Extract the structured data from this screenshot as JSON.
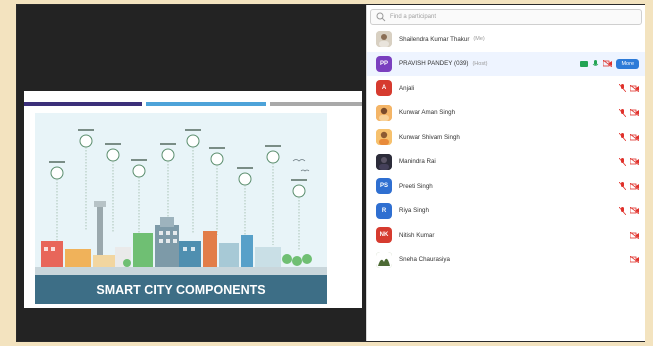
{
  "search": {
    "placeholder": "Find a participant"
  },
  "slide": {
    "caption": "SMART CITY COMPONENTS"
  },
  "participants": [
    {
      "name": "Shailendra Kumar Thakur",
      "tag": "(Me)",
      "initials": "",
      "avatar_color": "#cfc7b8",
      "avatar_type": "photo"
    },
    {
      "name": "PRAVISH PANDEY (039)",
      "tag": "(Host)",
      "initials": "PP",
      "avatar_color": "#7a3fbf",
      "avatar_type": "initials",
      "more_label": "More"
    },
    {
      "name": "Anjali",
      "tag": "",
      "initials": "A",
      "avatar_color": "#d63b2f",
      "avatar_type": "initials"
    },
    {
      "name": "Kunwar Aman Singh",
      "tag": "",
      "initials": "",
      "avatar_color": "#f0a24a",
      "avatar_type": "photo"
    },
    {
      "name": "Kunwar Shivam Singh",
      "tag": "",
      "initials": "",
      "avatar_color": "#f3b45a",
      "avatar_type": "photo"
    },
    {
      "name": "Manindra Rai",
      "tag": "",
      "initials": "",
      "avatar_color": "#2c2c3a",
      "avatar_type": "photo"
    },
    {
      "name": "Preeti Singh",
      "tag": "",
      "initials": "PS",
      "avatar_color": "#2f6fd1",
      "avatar_type": "initials"
    },
    {
      "name": "Riya Singh",
      "tag": "",
      "initials": "R",
      "avatar_color": "#2f6fd1",
      "avatar_type": "initials"
    },
    {
      "name": "Nitish Kumar",
      "tag": "",
      "initials": "NK",
      "avatar_color": "#d63b2f",
      "avatar_type": "initials"
    },
    {
      "name": "Sneha Chaurasiya",
      "tag": "",
      "initials": "",
      "avatar_color": "#6b8a4a",
      "avatar_type": "photo"
    }
  ],
  "colors": {
    "accent_blue": "#2d7bd8",
    "muted_red": "#e0312b",
    "video_green": "#23a454",
    "banner": "#3d6e86"
  }
}
